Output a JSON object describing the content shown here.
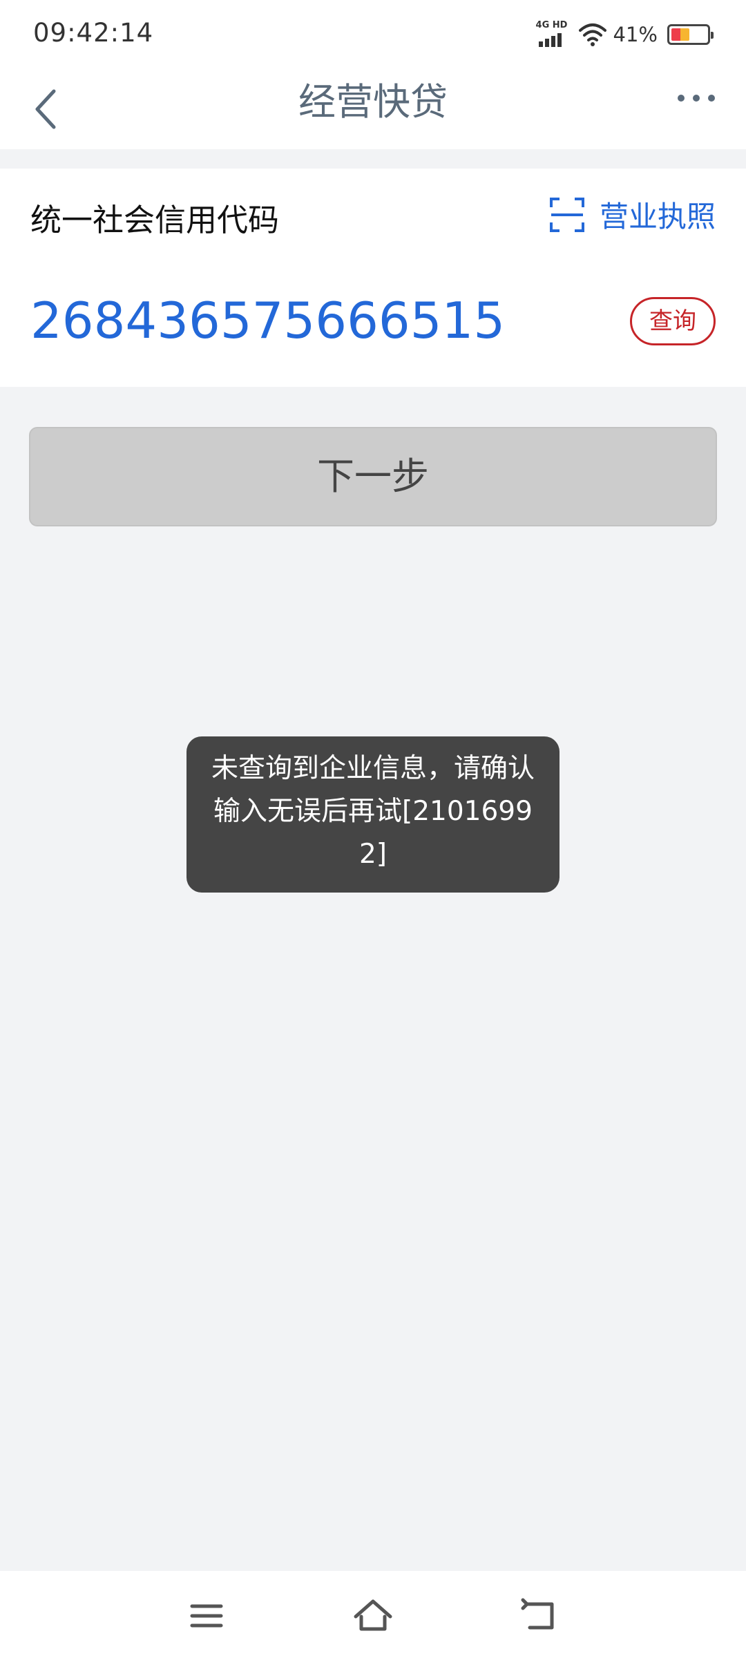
{
  "status_bar": {
    "time": "09:42:14",
    "network_label": "4G HD",
    "battery_percent": "41%",
    "battery_level": 0.41,
    "icons": [
      "signal-icon",
      "wifi-icon",
      "battery-icon"
    ]
  },
  "nav": {
    "title": "经营快贷",
    "back_icon": "chevron-left-icon",
    "more_icon": "more-dots-icon"
  },
  "form": {
    "code_label": "统一社会信用代码",
    "license_label": "营业执照",
    "license_icon": "scan-icon",
    "code_value": "268436575666515",
    "query_label": "查询"
  },
  "next_button": {
    "label": "下一步"
  },
  "toast": {
    "message": "未查询到企业信息，请确认输入无误后再试[21016992]"
  },
  "system_nav": {
    "icons": [
      "menu-icon",
      "home-icon",
      "back-icon"
    ]
  },
  "colors": {
    "accent_blue": "#2368d8",
    "query_red": "#c62428",
    "title_gray": "#5a6a7a",
    "disabled_button": "#cccccc",
    "toast_bg": "#454545",
    "page_bg": "#f2f3f5"
  }
}
